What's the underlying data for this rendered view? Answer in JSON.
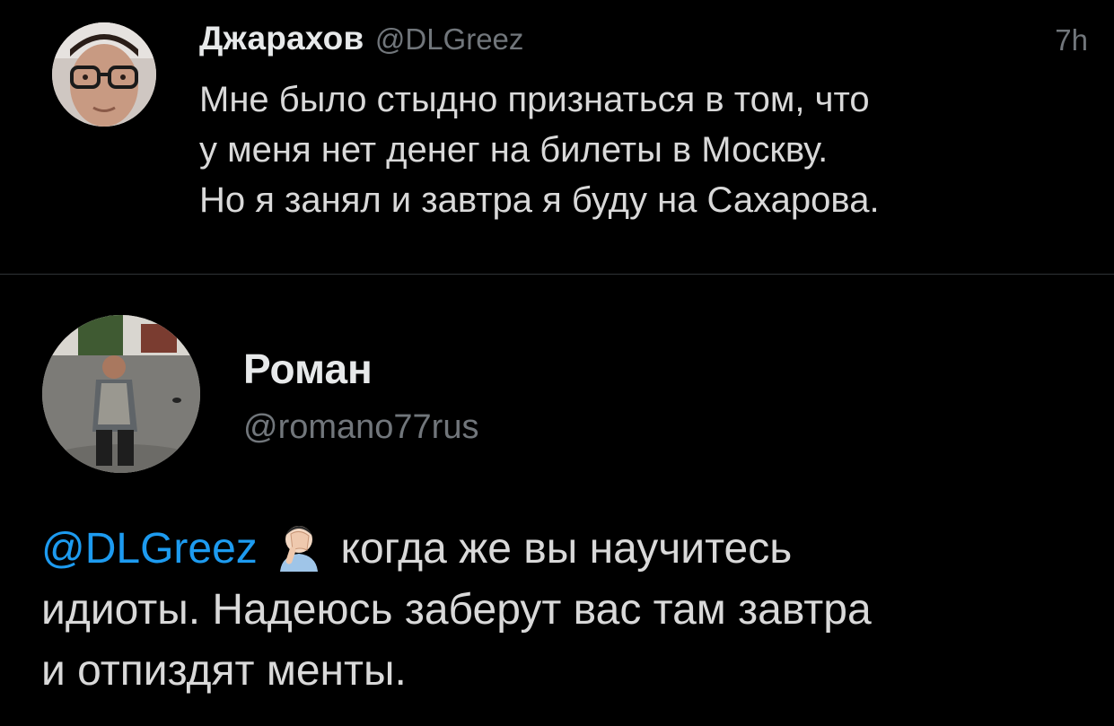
{
  "tweet": {
    "author": {
      "display_name": "Джарахов",
      "handle": "@DLGreez",
      "avatar_icon": "man-with-glasses-avatar"
    },
    "time": "7h",
    "lines": [
      "Мне было стыдно признаться в том, что",
      "у меня нет денег на билеты в Москву.",
      "Но я занял и завтра я буду на Сахарова."
    ]
  },
  "reply": {
    "author": {
      "display_name": "Роман",
      "handle": "@romano77rus",
      "avatar_icon": "man-on-street-photo-avatar"
    },
    "mention": "@DLGreez",
    "emoji": "facepalm-emoji",
    "line1_rest": "когда же вы научитесь",
    "line2": "идиоты. Надеюсь заберут вас там завтра",
    "line3": "и отпиздят менты."
  },
  "colors": {
    "background": "#000000",
    "text": "#d9d9d9",
    "secondary": "#71767b",
    "link": "#1d9bf0",
    "divider": "#2f3336"
  }
}
